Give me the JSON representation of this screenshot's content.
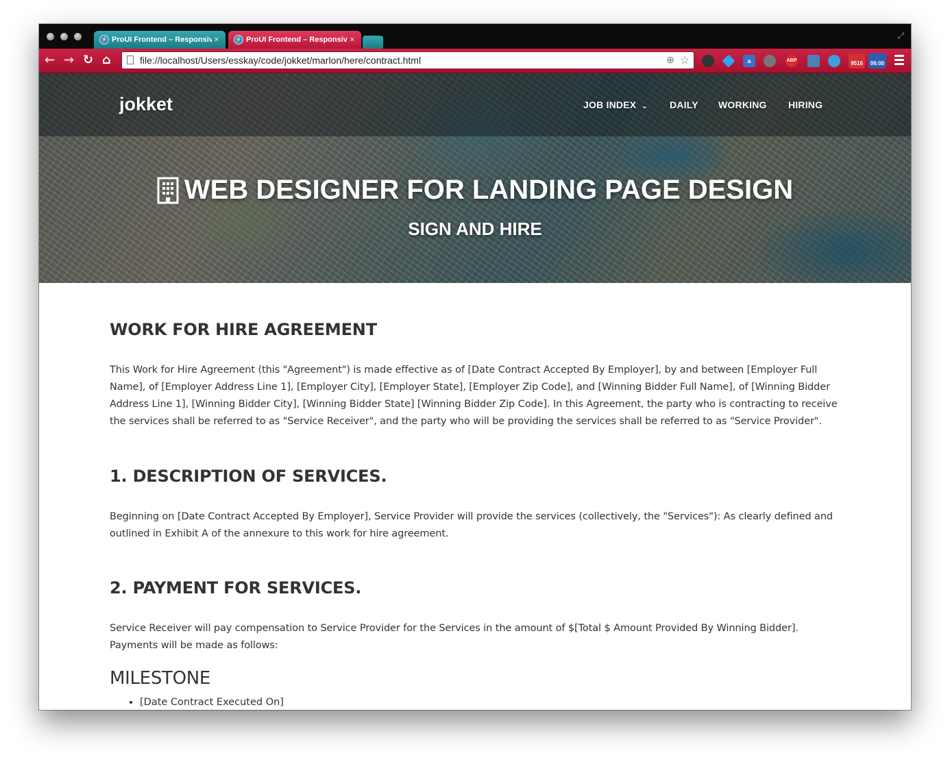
{
  "browser": {
    "tabs": [
      {
        "title": "ProUI Frontend – Responsive"
      },
      {
        "title": "ProUI Frontend – Responsive"
      }
    ],
    "url": "file://localhost/Users/esskay/code/jokket/marlon/here/contract.html",
    "extensions": [
      {
        "name": "ghost-icon",
        "color": "#333333",
        "label": ""
      },
      {
        "name": "diamond-icon",
        "color": "#2aa8f0",
        "label": ""
      },
      {
        "name": "a-icon",
        "color": "#3b6fc9",
        "label": "a"
      },
      {
        "name": "play-icon",
        "color": "#777777",
        "label": ""
      },
      {
        "name": "abp-icon",
        "color": "#e0282e",
        "label": "ABP"
      },
      {
        "name": "screen-icon",
        "color": "#4d7fb8",
        "label": ""
      },
      {
        "name": "clock-icon",
        "color": "#3aa0e0",
        "label": ""
      },
      {
        "name": "gmail-icon",
        "color": "#d23030",
        "label": "9516"
      },
      {
        "name": "calendar-icon",
        "color": "#2a5fb0",
        "label": "06:00"
      }
    ]
  },
  "site": {
    "brand": "jokket",
    "nav": [
      {
        "label": "JOB INDEX",
        "dropdown": true
      },
      {
        "label": "DAILY"
      },
      {
        "label": "WORKING"
      },
      {
        "label": "HIRING"
      }
    ],
    "hero_title": "WEB DESIGNER FOR LANDING PAGE DESIGN",
    "hero_subtitle": "SIGN AND HIRE"
  },
  "contract": {
    "title": "WORK FOR HIRE AGREEMENT",
    "intro": "This Work for Hire Agreement (this \"Agreement\") is made effective as of [Date Contract Accepted By Employer], by and between [Employer Full Name], of [Employer Address Line 1], [Employer City], [Employer State], [Employer Zip Code], and [Winning Bidder Full Name], of [Winning Bidder Address Line 1], [Winning Bidder City], [Winning Bidder State] [Winning Bidder Zip Code]. In this Agreement, the party who is contracting to receive the services shall be referred to as \"Service Receiver\", and the party who will be providing the services shall be referred to as \"Service Provider\".",
    "section1_title": "1. DESCRIPTION OF SERVICES.",
    "section1_text": "Beginning on [Date Contract Accepted By Employer], Service Provider will provide the services (collectively, the \"Services\"): As clearly defined and outlined in Exhibit A of the annexure to this work for hire agreement.",
    "section2_title": "2. PAYMENT FOR SERVICES.",
    "section2_text": "Service Receiver will pay compensation to Service Provider for the Services in the amount of $[Total $ Amount Provided By Winning Bidder]. Payments will be made as follows:",
    "milestone_title": "MILESTONE",
    "milestones": [
      "[Date Contract Executed On]"
    ]
  }
}
